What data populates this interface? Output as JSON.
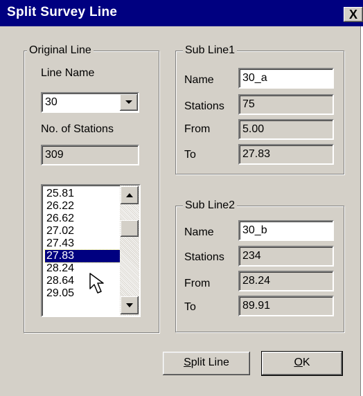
{
  "window": {
    "title": "Split Survey Line",
    "close_label": "X"
  },
  "original_line": {
    "group_title": "Original Line",
    "line_name_label": "Line Name",
    "line_name_value": "30",
    "num_stations_label": "No. of Stations",
    "num_stations_value": "309",
    "stations_list": [
      "25.81",
      "26.22",
      "26.62",
      "27.02",
      "27.43",
      "27.83",
      "28.24",
      "28.64",
      "29.05"
    ],
    "selected_station": "27.83"
  },
  "sub_line1": {
    "group_title": "Sub Line1",
    "name_label": "Name",
    "name_value": "30_a",
    "stations_label": "Stations",
    "stations_value": "75",
    "from_label": "From",
    "from_value": "5.00",
    "to_label": "To",
    "to_value": "27.83"
  },
  "sub_line2": {
    "group_title": "Sub Line2",
    "name_label": "Name",
    "name_value": "30_b",
    "stations_label": "Stations",
    "stations_value": "234",
    "from_label": "From",
    "from_value": "28.24",
    "to_label": "To",
    "to_value": "89.91"
  },
  "buttons": {
    "split_line": {
      "mnemonic": "S",
      "rest": "plit Line"
    },
    "ok": {
      "mnemonic": "O",
      "rest": "K"
    }
  },
  "colors": {
    "face": "#d4d0c8",
    "title_bar": "#000080",
    "selection": "#000080"
  }
}
